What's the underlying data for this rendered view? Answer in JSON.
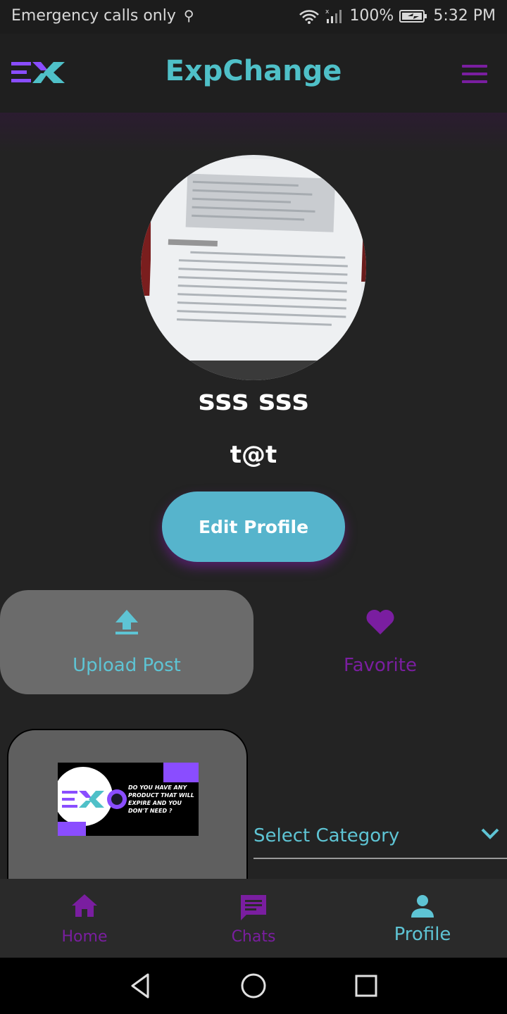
{
  "status_bar": {
    "carrier": "Emergency calls only",
    "battery": "100%",
    "time": "5:32 PM"
  },
  "app_bar": {
    "title": "ExpChange"
  },
  "profile": {
    "name": "sss sss",
    "email": "t@t",
    "edit_button": "Edit Profile"
  },
  "tabs": {
    "upload_label": "Upload Post",
    "favorite_label": "Favorite"
  },
  "post": {
    "image_text": "DO YOU HAVE ANY PRODUCT THAT WILL EXPIRE AND YOU DON'T NEED ?"
  },
  "category": {
    "label": "Select Category"
  },
  "bottom_nav": {
    "home": "Home",
    "chats": "Chats",
    "profile": "Profile",
    "active": "profile"
  },
  "colors": {
    "teal": "#4fc0c8",
    "purple": "#7a1ea0",
    "background": "#232323"
  }
}
